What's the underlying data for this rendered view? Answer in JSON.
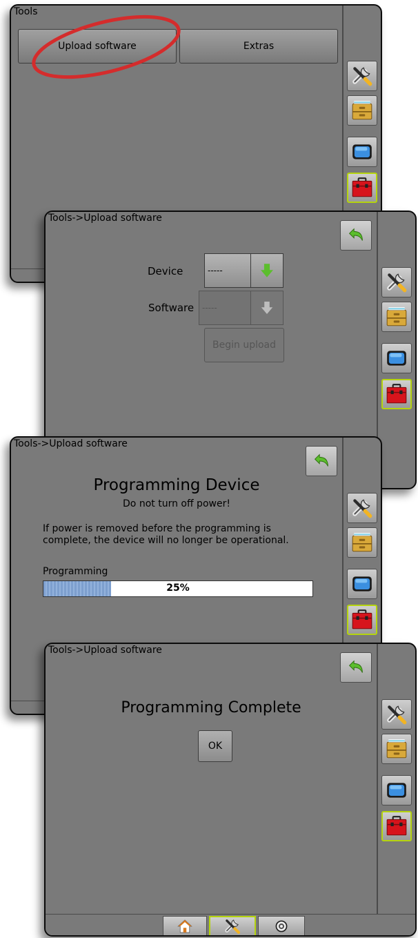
{
  "screen1": {
    "title": "Tools",
    "tabs": [
      "Upload software",
      "Extras"
    ]
  },
  "screen2": {
    "title": "Tools->Upload software",
    "device_label": "Device",
    "device_value": "-----",
    "software_label": "Software",
    "software_value": "-----",
    "begin_label": "Begin upload"
  },
  "screen3": {
    "title": "Tools->Upload software",
    "heading": "Programming Device",
    "subheading": "Do not turn off power!",
    "warning": "If power is removed before the programming is complete, the device will no longer be operational.",
    "progress_label": "Programming",
    "progress_text": "25%",
    "progress_value": 0.25
  },
  "screen4": {
    "title": "Tools->Upload software",
    "heading": "Programming Complete",
    "ok_label": "OK"
  },
  "sidebar_icons": [
    "tools-icon",
    "file-cabinet-icon",
    "monitor-icon",
    "toolbox-icon"
  ],
  "bottom_nav_icons": [
    "home-icon",
    "tools-icon",
    "gauge-icon"
  ],
  "colors": {
    "screen_bg": "#7a7a7a",
    "active_border": "#b5d40e",
    "highlight_circle": "#d42c2c",
    "progress_fill": "#7d9fce",
    "back_arrow": "#5cbe2d"
  }
}
